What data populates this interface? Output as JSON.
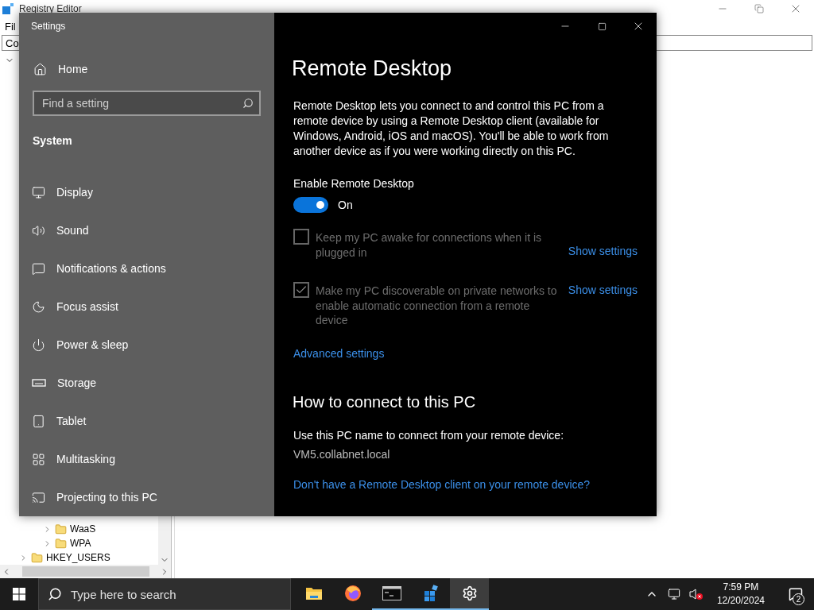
{
  "background_window": {
    "title": "Registry Editor",
    "menu": [
      "Fil"
    ],
    "address": "Co",
    "tree": [
      {
        "label": "WaaS",
        "expanded": false
      },
      {
        "label": "WPA",
        "expanded": false
      }
    ],
    "root": {
      "label": "HKEY_USERS",
      "expanded": false
    }
  },
  "settings_window": {
    "title": "Settings",
    "sidebar": {
      "home": "Home",
      "search": {
        "placeholder": "Find a setting"
      },
      "section": "System",
      "items": [
        {
          "label": "Display",
          "kind": "display",
          "selected": false
        },
        {
          "label": "Sound",
          "kind": "sound",
          "selected": false
        },
        {
          "label": "Notifications & actions",
          "kind": "notifications",
          "selected": false
        },
        {
          "label": "Focus assist",
          "kind": "focus",
          "selected": false
        },
        {
          "label": "Power & sleep",
          "kind": "power",
          "selected": false
        },
        {
          "label": "Storage",
          "kind": "storage",
          "selected": false
        },
        {
          "label": "Tablet",
          "kind": "tablet",
          "selected": false
        },
        {
          "label": "Multitasking",
          "kind": "multitasking",
          "selected": false
        },
        {
          "label": "Projecting to this PC",
          "kind": "projecting",
          "selected": false
        }
      ]
    },
    "page": {
      "title": "Remote Desktop",
      "description": "Remote Desktop lets you connect to and control this PC from a remote device by using a Remote Desktop client (available for Windows, Android, iOS and macOS). You'll be able to work from another device as if you were working directly on this PC.",
      "enable": {
        "label": "Enable Remote Desktop",
        "on": true,
        "state_text": "On"
      },
      "options": [
        {
          "label": "Keep my PC awake for connections when it is plugged in",
          "checked": false,
          "disabled": true,
          "link": "Show settings"
        },
        {
          "label": "Make my PC discoverable on private networks to enable automatic connection from a remote device",
          "checked": true,
          "disabled": true,
          "link": "Show settings"
        }
      ],
      "advanced_link": "Advanced settings",
      "connect_heading": "How to connect to this PC",
      "connect_text": "Use this PC name to connect from your remote device:",
      "pc_name": "VM5.collabnet.local",
      "client_link": "Don't have a Remote Desktop client on your remote device?"
    }
  },
  "taskbar": {
    "search": {
      "placeholder": "Type here to search"
    },
    "apps": [
      {
        "kind": "explorer",
        "running": false,
        "selected": false
      },
      {
        "kind": "firefox",
        "running": false,
        "selected": false
      },
      {
        "kind": "terminal",
        "running": true,
        "selected": false
      },
      {
        "kind": "registry",
        "running": true,
        "selected": false
      },
      {
        "kind": "settings",
        "running": true,
        "selected": true
      }
    ],
    "time": "7:59 PM",
    "date": "12/20/2024",
    "notifications": "2"
  }
}
